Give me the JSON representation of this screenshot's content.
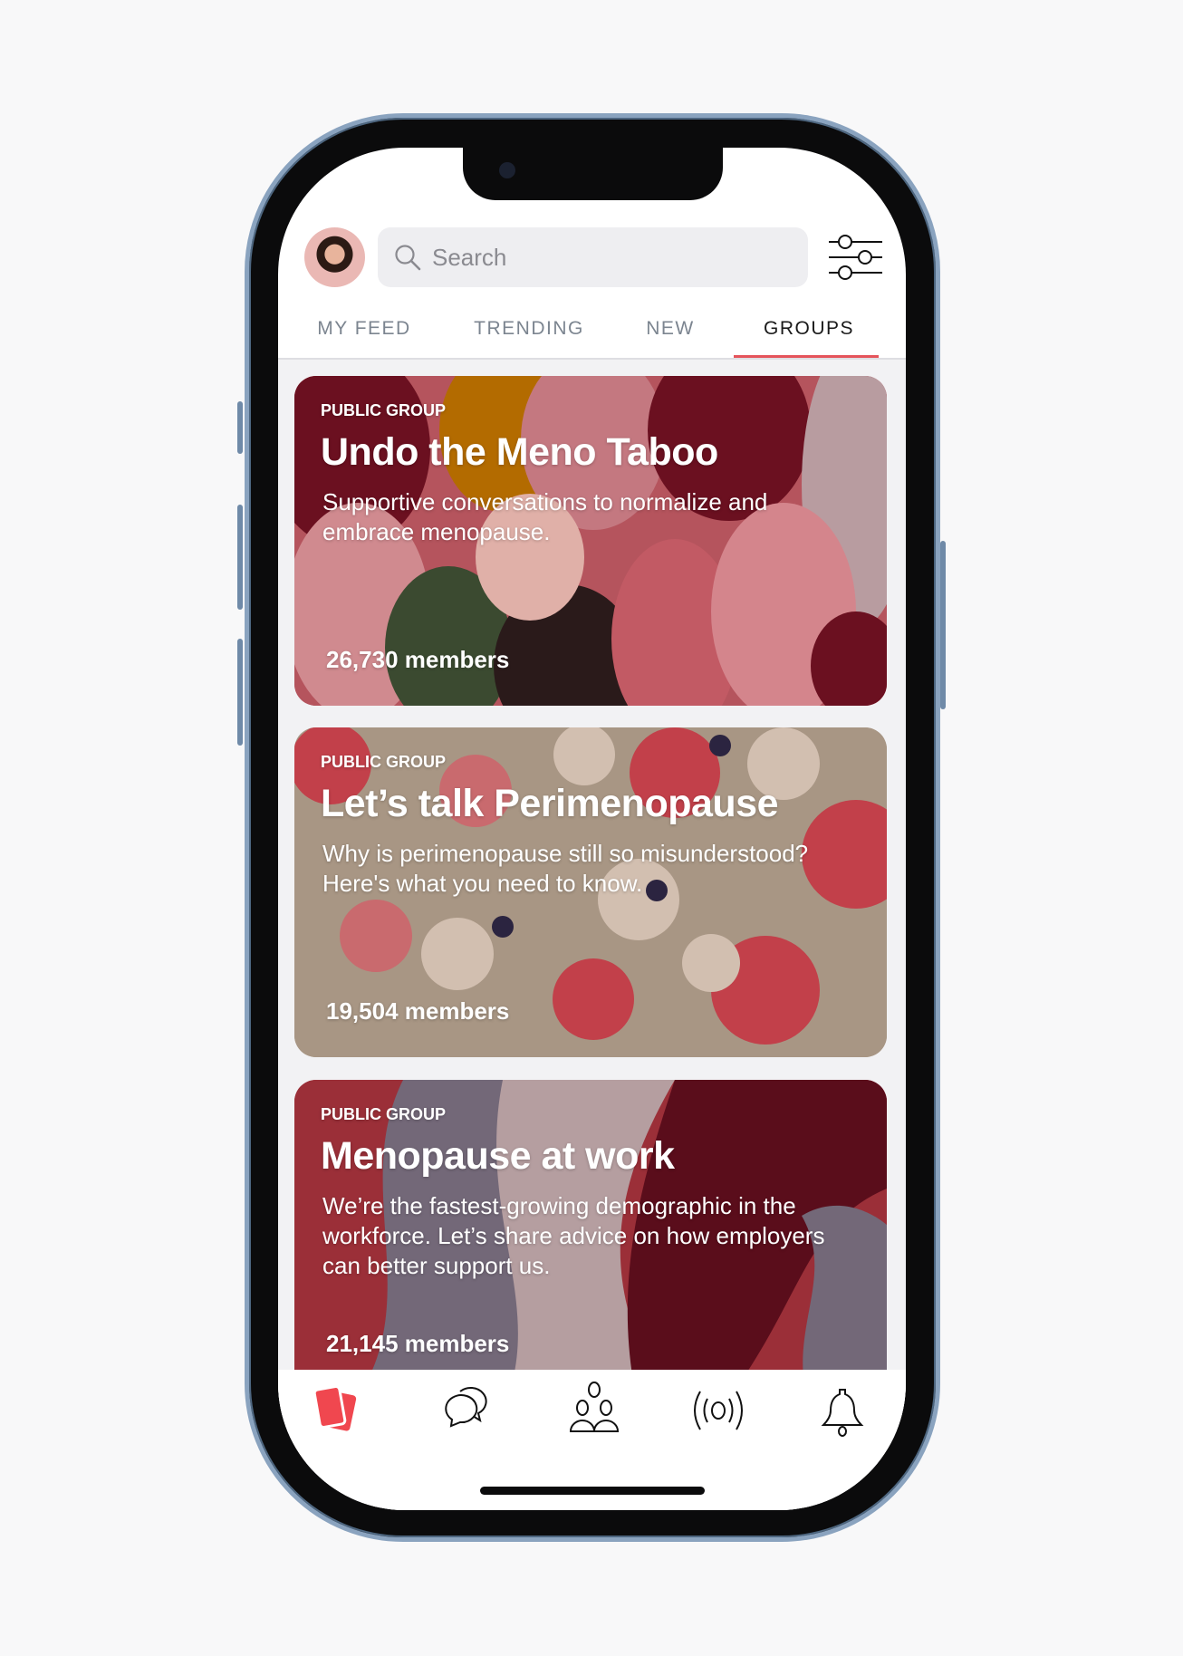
{
  "header": {
    "search_placeholder": "Search"
  },
  "tabs": [
    {
      "label": "MY FEED"
    },
    {
      "label": "TRENDING"
    },
    {
      "label": "NEW"
    },
    {
      "label": "GROUPS",
      "active": true
    }
  ],
  "groups": [
    {
      "type": "PUBLIC GROUP",
      "title": "Undo the Meno Taboo",
      "description": "Supportive conversations to normalize and embrace menopause.",
      "members": "26,730 members"
    },
    {
      "type": "PUBLIC GROUP",
      "title": "Let’s talk Perimenopause",
      "description": "Why is perimenopause still so misunderstood? Here's what you need to know.",
      "members": "19,504 members"
    },
    {
      "type": "PUBLIC GROUP",
      "title": "Menopause at work",
      "description": "We’re the fastest-growing demographic in the workforce. Let’s share advice on how employers can better support us.",
      "members": "21,145 members"
    }
  ],
  "tabbar": {
    "items": [
      {
        "icon": "cards-icon",
        "active": true
      },
      {
        "icon": "chat-bubbles-icon"
      },
      {
        "icon": "groups-icon"
      },
      {
        "icon": "broadcast-icon"
      },
      {
        "icon": "bell-icon"
      }
    ]
  },
  "colors": {
    "accent": "#e5545b",
    "tab_active": "#1a1a1a",
    "tab_inactive": "#7c8590"
  }
}
